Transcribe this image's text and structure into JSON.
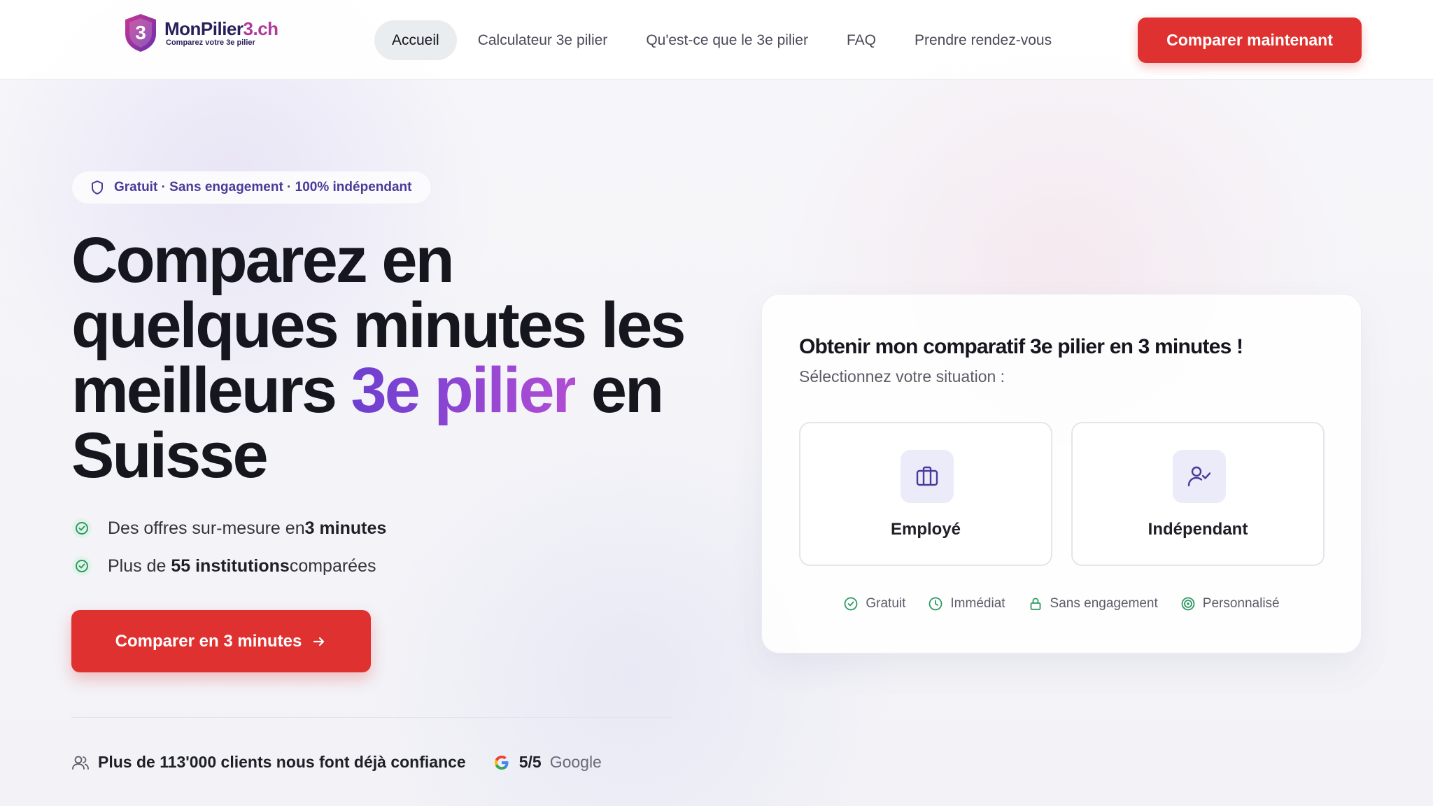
{
  "brand": {
    "name_part1": "MonPilier",
    "name_part2": "3.ch",
    "tagline": "Comparez votre 3e pilier",
    "shield_number": "3",
    "colors": {
      "primary": "#2a1f5a",
      "accent": "#b03a98",
      "cta": "#e03131"
    }
  },
  "nav": {
    "items": [
      {
        "label": "Accueil",
        "active": true
      },
      {
        "label": "Calculateur 3e pilier",
        "active": false
      },
      {
        "label": "Qu'est-ce que le 3e pilier",
        "active": false
      },
      {
        "label": "FAQ",
        "active": false
      },
      {
        "label": "Prendre rendez-vous",
        "active": false
      }
    ],
    "cta_label": "Comparer maintenant"
  },
  "hero": {
    "badge": {
      "icon": "shield-icon",
      "text": "Gratuit · Sans engagement · 100% indépendant"
    },
    "title_part1": "Comparez en quelques minutes les meilleurs ",
    "title_highlight": "3e pilier",
    "title_part2": " en Suisse",
    "checks": [
      {
        "icon": "check-circle-icon",
        "pre": "Des offres sur-mesure en ",
        "bold": "3 minutes",
        "post": ""
      },
      {
        "icon": "check-circle-icon",
        "pre": "Plus de ",
        "bold": "55 institutions",
        "post": " comparées"
      }
    ],
    "cta_label": "Comparer en 3 minutes",
    "cta_icon": "arrow-right-icon"
  },
  "trust": {
    "clients_icon": "users-icon",
    "clients_text": "Plus de 113'000 clients nous font déjà confiance",
    "rating_icon": "google-icon",
    "rating": "5/5",
    "rating_source": "Google"
  },
  "card": {
    "title": "Obtenir mon comparatif 3e pilier en 3 minutes !",
    "subtitle": "Sélectionnez votre situation :",
    "options": [
      {
        "label": "Employé",
        "icon": "briefcase-icon"
      },
      {
        "label": "Indépendant",
        "icon": "user-check-icon"
      }
    ],
    "features": [
      {
        "label": "Gratuit",
        "icon": "check-circle-icon"
      },
      {
        "label": "Immédiat",
        "icon": "clock-icon"
      },
      {
        "label": "Sans engagement",
        "icon": "lock-icon"
      },
      {
        "label": "Personnalisé",
        "icon": "target-icon"
      }
    ]
  }
}
